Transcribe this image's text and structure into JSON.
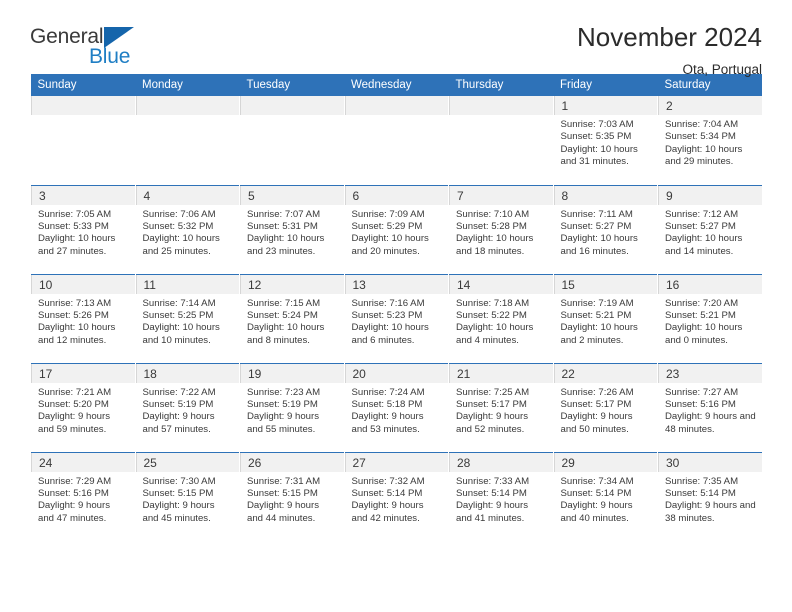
{
  "logo": {
    "word_one": "General",
    "word_two": "Blue",
    "flag_icon": "triangle-flag-icon"
  },
  "header": {
    "title": "November 2024",
    "subtitle": "Ota, Portugal"
  },
  "calendar": {
    "day_names": [
      "Sunday",
      "Monday",
      "Tuesday",
      "Wednesday",
      "Thursday",
      "Friday",
      "Saturday"
    ],
    "accent_color": "#2e72b8",
    "day_band_color": "#f1f1f1",
    "weeks": [
      [
        {
          "day": "",
          "empty": true
        },
        {
          "day": "",
          "empty": true
        },
        {
          "day": "",
          "empty": true
        },
        {
          "day": "",
          "empty": true
        },
        {
          "day": "",
          "empty": true
        },
        {
          "day": "1",
          "sunrise": "Sunrise: 7:03 AM",
          "sunset": "Sunset: 5:35 PM",
          "daylight": "Daylight: 10 hours and 31 minutes."
        },
        {
          "day": "2",
          "sunrise": "Sunrise: 7:04 AM",
          "sunset": "Sunset: 5:34 PM",
          "daylight": "Daylight: 10 hours and 29 minutes."
        }
      ],
      [
        {
          "day": "3",
          "sunrise": "Sunrise: 7:05 AM",
          "sunset": "Sunset: 5:33 PM",
          "daylight": "Daylight: 10 hours and 27 minutes."
        },
        {
          "day": "4",
          "sunrise": "Sunrise: 7:06 AM",
          "sunset": "Sunset: 5:32 PM",
          "daylight": "Daylight: 10 hours and 25 minutes."
        },
        {
          "day": "5",
          "sunrise": "Sunrise: 7:07 AM",
          "sunset": "Sunset: 5:31 PM",
          "daylight": "Daylight: 10 hours and 23 minutes."
        },
        {
          "day": "6",
          "sunrise": "Sunrise: 7:09 AM",
          "sunset": "Sunset: 5:29 PM",
          "daylight": "Daylight: 10 hours and 20 minutes."
        },
        {
          "day": "7",
          "sunrise": "Sunrise: 7:10 AM",
          "sunset": "Sunset: 5:28 PM",
          "daylight": "Daylight: 10 hours and 18 minutes."
        },
        {
          "day": "8",
          "sunrise": "Sunrise: 7:11 AM",
          "sunset": "Sunset: 5:27 PM",
          "daylight": "Daylight: 10 hours and 16 minutes."
        },
        {
          "day": "9",
          "sunrise": "Sunrise: 7:12 AM",
          "sunset": "Sunset: 5:27 PM",
          "daylight": "Daylight: 10 hours and 14 minutes."
        }
      ],
      [
        {
          "day": "10",
          "sunrise": "Sunrise: 7:13 AM",
          "sunset": "Sunset: 5:26 PM",
          "daylight": "Daylight: 10 hours and 12 minutes."
        },
        {
          "day": "11",
          "sunrise": "Sunrise: 7:14 AM",
          "sunset": "Sunset: 5:25 PM",
          "daylight": "Daylight: 10 hours and 10 minutes."
        },
        {
          "day": "12",
          "sunrise": "Sunrise: 7:15 AM",
          "sunset": "Sunset: 5:24 PM",
          "daylight": "Daylight: 10 hours and 8 minutes."
        },
        {
          "day": "13",
          "sunrise": "Sunrise: 7:16 AM",
          "sunset": "Sunset: 5:23 PM",
          "daylight": "Daylight: 10 hours and 6 minutes."
        },
        {
          "day": "14",
          "sunrise": "Sunrise: 7:18 AM",
          "sunset": "Sunset: 5:22 PM",
          "daylight": "Daylight: 10 hours and 4 minutes."
        },
        {
          "day": "15",
          "sunrise": "Sunrise: 7:19 AM",
          "sunset": "Sunset: 5:21 PM",
          "daylight": "Daylight: 10 hours and 2 minutes."
        },
        {
          "day": "16",
          "sunrise": "Sunrise: 7:20 AM",
          "sunset": "Sunset: 5:21 PM",
          "daylight": "Daylight: 10 hours and 0 minutes."
        }
      ],
      [
        {
          "day": "17",
          "sunrise": "Sunrise: 7:21 AM",
          "sunset": "Sunset: 5:20 PM",
          "daylight": "Daylight: 9 hours and 59 minutes."
        },
        {
          "day": "18",
          "sunrise": "Sunrise: 7:22 AM",
          "sunset": "Sunset: 5:19 PM",
          "daylight": "Daylight: 9 hours and 57 minutes."
        },
        {
          "day": "19",
          "sunrise": "Sunrise: 7:23 AM",
          "sunset": "Sunset: 5:19 PM",
          "daylight": "Daylight: 9 hours and 55 minutes."
        },
        {
          "day": "20",
          "sunrise": "Sunrise: 7:24 AM",
          "sunset": "Sunset: 5:18 PM",
          "daylight": "Daylight: 9 hours and 53 minutes."
        },
        {
          "day": "21",
          "sunrise": "Sunrise: 7:25 AM",
          "sunset": "Sunset: 5:17 PM",
          "daylight": "Daylight: 9 hours and 52 minutes."
        },
        {
          "day": "22",
          "sunrise": "Sunrise: 7:26 AM",
          "sunset": "Sunset: 5:17 PM",
          "daylight": "Daylight: 9 hours and 50 minutes."
        },
        {
          "day": "23",
          "sunrise": "Sunrise: 7:27 AM",
          "sunset": "Sunset: 5:16 PM",
          "daylight": "Daylight: 9 hours and 48 minutes."
        }
      ],
      [
        {
          "day": "24",
          "sunrise": "Sunrise: 7:29 AM",
          "sunset": "Sunset: 5:16 PM",
          "daylight": "Daylight: 9 hours and 47 minutes."
        },
        {
          "day": "25",
          "sunrise": "Sunrise: 7:30 AM",
          "sunset": "Sunset: 5:15 PM",
          "daylight": "Daylight: 9 hours and 45 minutes."
        },
        {
          "day": "26",
          "sunrise": "Sunrise: 7:31 AM",
          "sunset": "Sunset: 5:15 PM",
          "daylight": "Daylight: 9 hours and 44 minutes."
        },
        {
          "day": "27",
          "sunrise": "Sunrise: 7:32 AM",
          "sunset": "Sunset: 5:14 PM",
          "daylight": "Daylight: 9 hours and 42 minutes."
        },
        {
          "day": "28",
          "sunrise": "Sunrise: 7:33 AM",
          "sunset": "Sunset: 5:14 PM",
          "daylight": "Daylight: 9 hours and 41 minutes."
        },
        {
          "day": "29",
          "sunrise": "Sunrise: 7:34 AM",
          "sunset": "Sunset: 5:14 PM",
          "daylight": "Daylight: 9 hours and 40 minutes."
        },
        {
          "day": "30",
          "sunrise": "Sunrise: 7:35 AM",
          "sunset": "Sunset: 5:14 PM",
          "daylight": "Daylight: 9 hours and 38 minutes."
        }
      ]
    ]
  }
}
